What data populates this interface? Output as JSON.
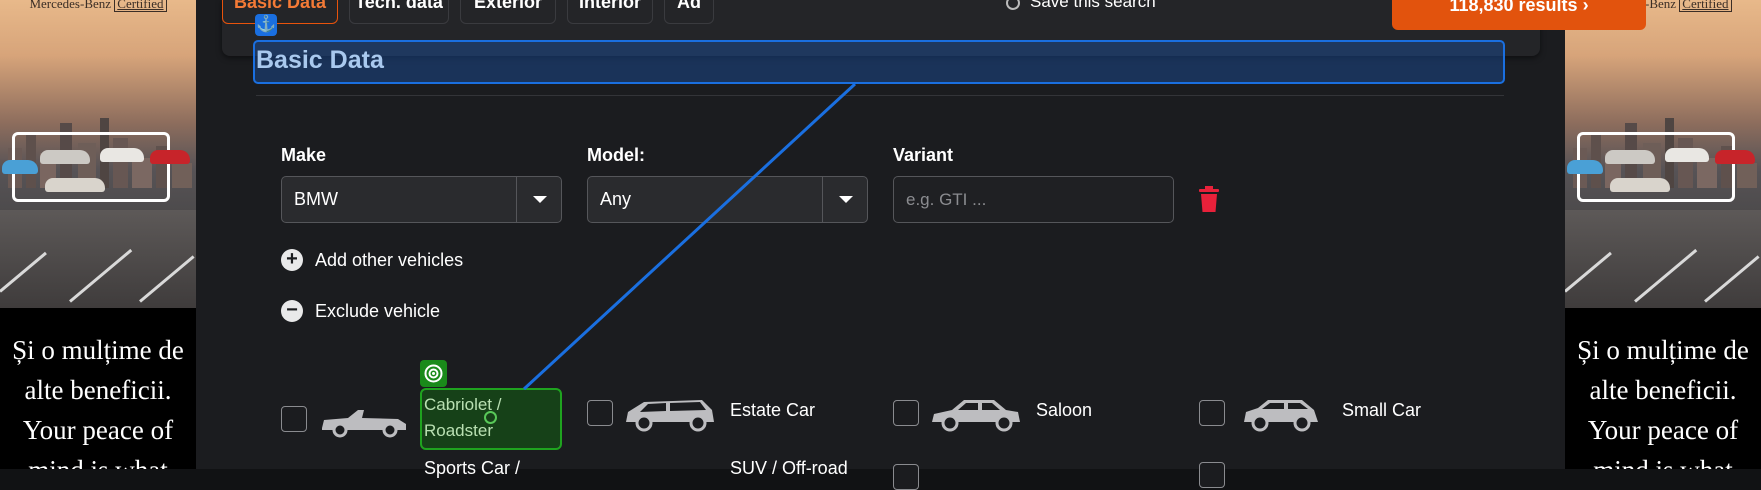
{
  "ad": {
    "brand": "Mercedes-Benz",
    "certified": "Certified",
    "text": "Și o mulțime de alte beneficii. Your peace of mind is what"
  },
  "tabs": [
    {
      "label": "Basic Data",
      "active": true
    },
    {
      "label": "Tech. data",
      "active": false
    },
    {
      "label": "Exterior",
      "active": false
    },
    {
      "label": "Interior",
      "active": false
    },
    {
      "label": "Ad",
      "active": false
    }
  ],
  "header": {
    "save_search": "Save this search",
    "results_button": "118,830 results"
  },
  "section": {
    "title": "Basic Data"
  },
  "fields": {
    "make": {
      "label": "Make",
      "value": "BMW"
    },
    "model": {
      "label": "Model:",
      "value": "Any"
    },
    "variant": {
      "label": "Variant",
      "placeholder": "e.g. GTI ..."
    }
  },
  "actions": {
    "add_other": "Add other vehicles",
    "exclude": "Exclude vehicle"
  },
  "body_types": [
    {
      "label": "Cabriolet / Roadster",
      "checked": false,
      "icon": "cabriolet-icon"
    },
    {
      "label": "Estate Car",
      "checked": false,
      "icon": "estate-car-icon"
    },
    {
      "label": "Saloon",
      "checked": false,
      "icon": "saloon-icon"
    },
    {
      "label": "Small Car",
      "checked": false,
      "icon": "small-car-icon"
    }
  ],
  "cut_off_row": {
    "label1": "Sports Car /",
    "label2": "SUV / Off-road"
  },
  "colors": {
    "accent": "#e2530d",
    "highlight_blue": "#1a6fe0",
    "highlight_green": "#1fa31f",
    "trash": "#e8213a"
  }
}
